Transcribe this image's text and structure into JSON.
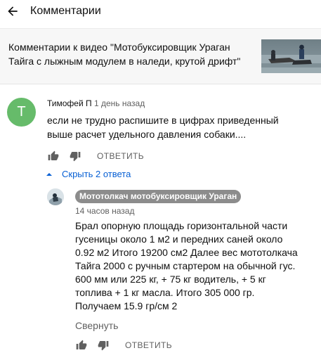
{
  "header": {
    "title": "Комментарии",
    "back_icon": "arrow-left-icon"
  },
  "video": {
    "title": "Комментарии к видео \"Мотобуксировщик Ураган Тайга с лыжным модулем в наледи, крутой дрифт\"",
    "thumbnail": "video-thumbnail"
  },
  "comment": {
    "avatar_letter": "T",
    "avatar_color": "#66bb6a",
    "author": "Тимофей П",
    "time": "1 день назад",
    "text": "если не трудно распишите в цифрах приведенный выше расчет удельного давления собаки....",
    "reply_label": "ОТВЕТИТЬ",
    "like_icon": "thumbs-up-icon",
    "dislike_icon": "thumbs-down-icon"
  },
  "replies_toggle": {
    "label": "Скрыть 2 ответа",
    "icon": "chevron-up-icon",
    "color": "#065fd4"
  },
  "reply": {
    "author": "Мототолкач мотобуксировщик Ураган",
    "author_chip_color": "#8c8c8c",
    "time": "14 часов назад",
    "text": "Брал опорную площадь горизонтальной части гусеницы около 1 м2 и передних саней около 0.92 м2  Итого 19200 см2 Далее вес мототолкача Тайга 2000 с ручным стартером на обычной гус. 600 мм или 225 кг, + 75 кг водитель, + 5 кг топлива + 1 кг масла. Итого 305 000 гр. Получаем 15.9 гр/см 2",
    "collapse_label": "Свернуть",
    "reply_label": "ОТВЕТИТЬ",
    "like_icon": "thumbs-up-icon",
    "dislike_icon": "thumbs-down-icon"
  }
}
